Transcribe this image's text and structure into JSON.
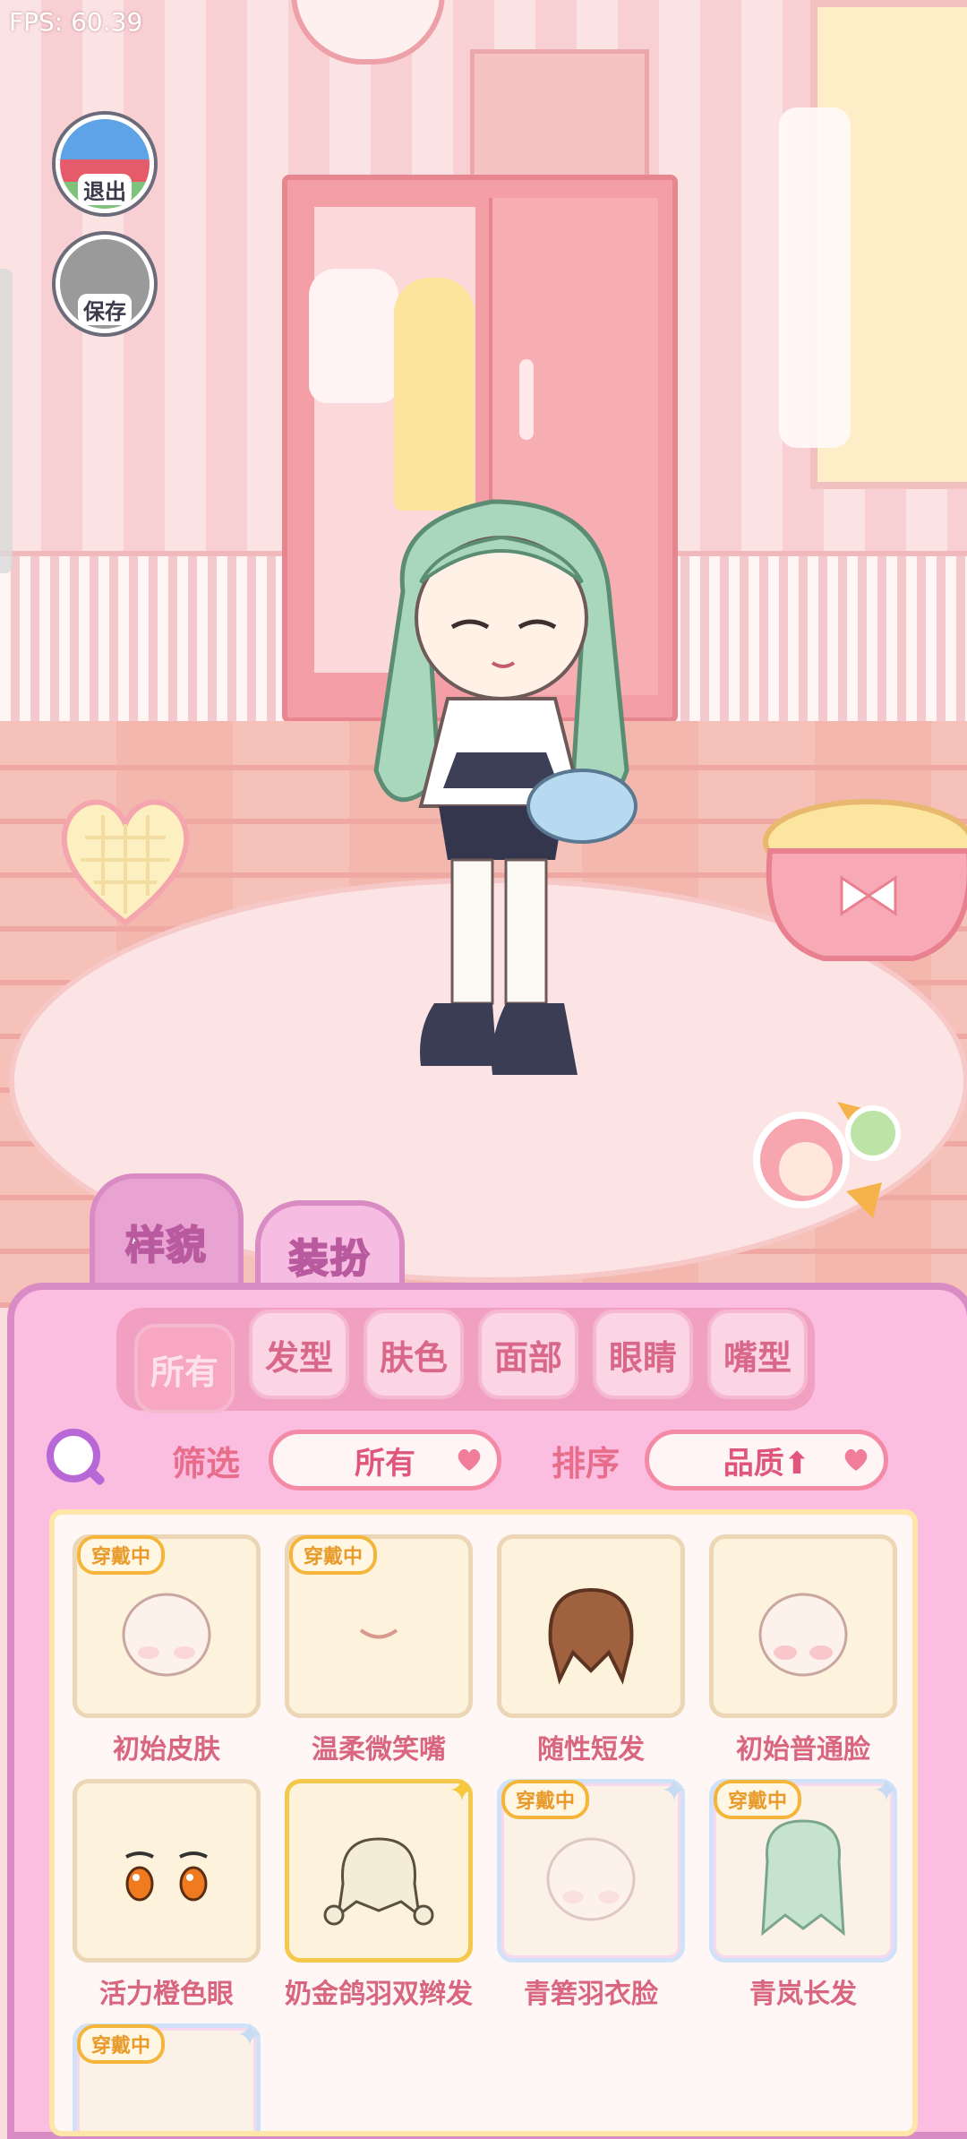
{
  "fps": "FPS: 60.39",
  "side_buttons": {
    "exit": "退出",
    "save": "保存"
  },
  "main_tabs": [
    "样貌",
    "装扮"
  ],
  "categories": [
    "所有",
    "发型",
    "肤色",
    "面部",
    "眼睛",
    "嘴型"
  ],
  "filter": {
    "label": "筛选",
    "value": "所有"
  },
  "sort": {
    "label": "排序",
    "value": "品质⬆"
  },
  "badge_text": "穿戴中",
  "items": [
    {
      "name": "初始皮肤",
      "equipped": true,
      "icon": "face-skin-icon"
    },
    {
      "name": "温柔微笑嘴",
      "equipped": true,
      "icon": "smile-mouth-icon"
    },
    {
      "name": "随性短发",
      "equipped": false,
      "icon": "short-hair-icon"
    },
    {
      "name": "初始普通脸",
      "equipped": false,
      "icon": "plain-face-icon"
    },
    {
      "name": "活力橙色眼",
      "equipped": false,
      "icon": "orange-eyes-icon"
    },
    {
      "name": "奶金鸽羽双辫发",
      "equipped": false,
      "icon": "braid-hair-icon"
    },
    {
      "name": "青箬羽衣脸",
      "equipped": true,
      "icon": "feather-face-icon"
    },
    {
      "name": "青岚长发",
      "equipped": true,
      "icon": "long-hair-icon"
    },
    {
      "name": "",
      "equipped": true,
      "icon": "item-icon"
    }
  ],
  "colors": {
    "accent": "#e86d8b",
    "panel": "#fbbde0",
    "badge": "#f5b53a"
  }
}
